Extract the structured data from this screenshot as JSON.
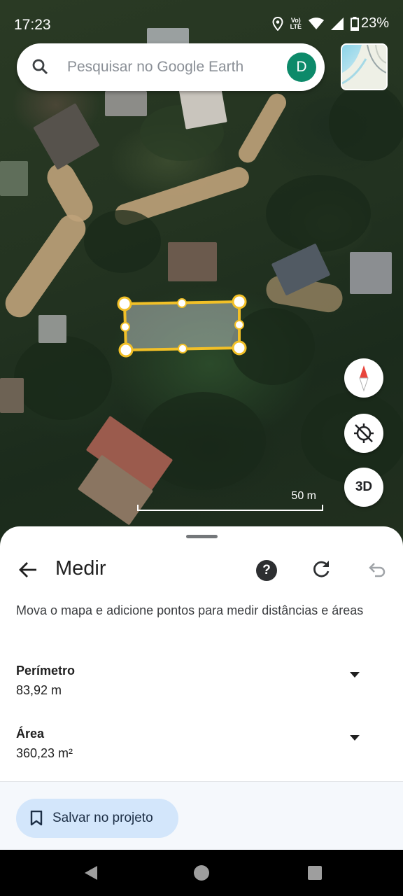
{
  "status_bar": {
    "time": "17:23",
    "network_label": "LTE",
    "battery": "23%"
  },
  "search": {
    "placeholder": "Pesquisar no Google Earth",
    "avatar_letter": "D"
  },
  "map": {
    "scale_label": "50 m",
    "button_3d": "3D",
    "measurement_color": "#f2c027"
  },
  "sheet": {
    "title": "Medir",
    "help_symbol": "?",
    "instructions": "Mova o mapa e adicione pontos para medir distâncias e áreas",
    "perimeter": {
      "label": "Perímetro",
      "value": "83,92 m"
    },
    "area": {
      "label": "Área",
      "value": "360,23 m²"
    },
    "save_label": "Salvar no projeto"
  },
  "icons": {
    "search": "search-icon",
    "layers": "layers-icon",
    "compass": "compass-icon",
    "location": "location-off-icon",
    "back": "arrow-back-icon",
    "help": "help-icon",
    "redo": "redo-icon",
    "undo": "undo-icon",
    "bookmark": "bookmark-icon"
  }
}
